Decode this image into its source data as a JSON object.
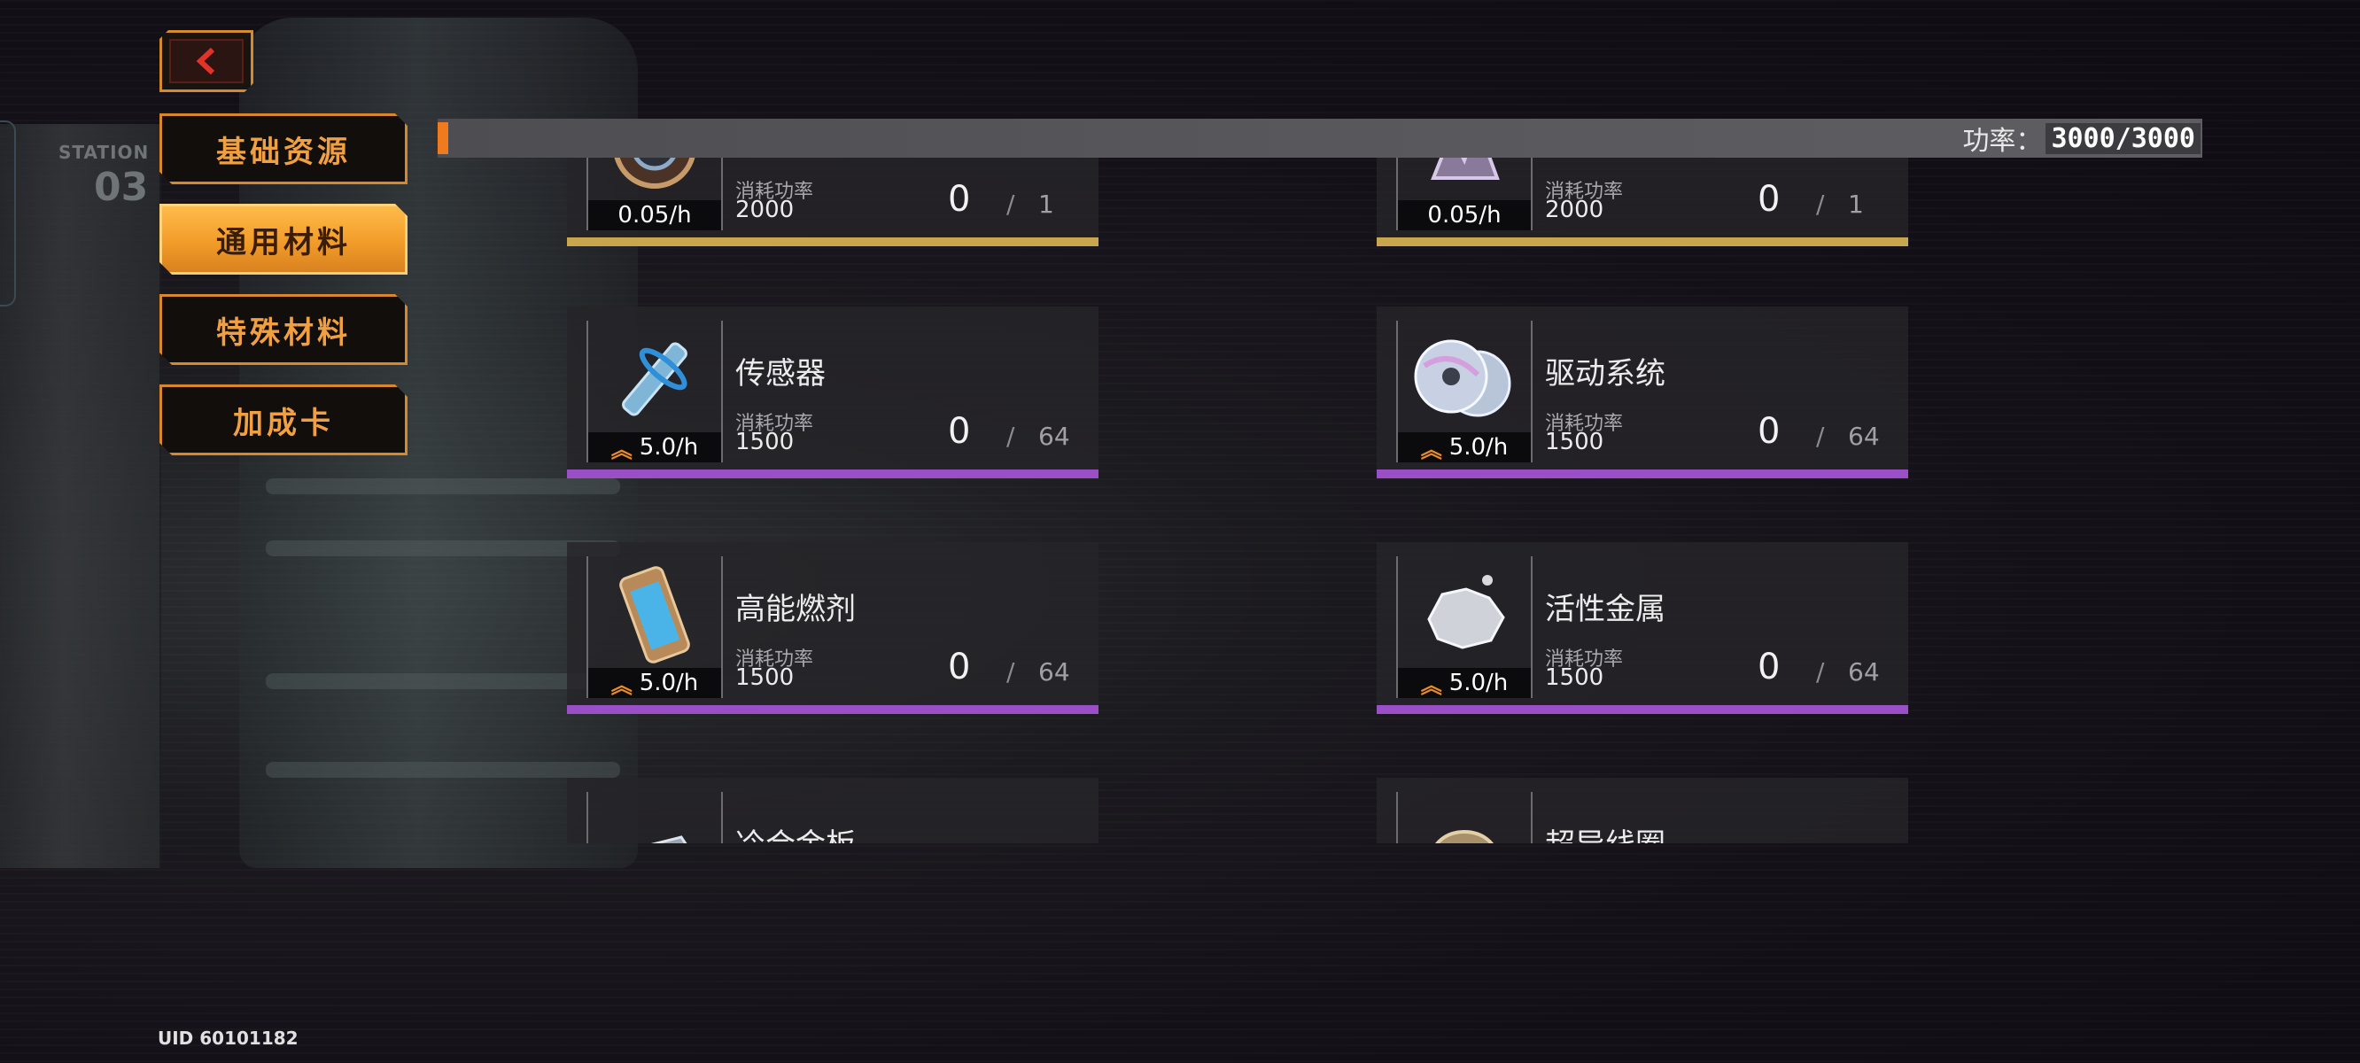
{
  "station": {
    "label": "STATION",
    "number": "03"
  },
  "tabs": [
    {
      "label": "基础资源",
      "active": false
    },
    {
      "label": "通用材料",
      "active": true
    },
    {
      "label": "特殊材料",
      "active": false
    },
    {
      "label": "加成卡",
      "active": false
    }
  ],
  "power": {
    "label": "功率：",
    "value": "3000/3000"
  },
  "consume_label": "消耗功率",
  "items": [
    {
      "name": "",
      "rate": "0.05/h",
      "consume": "2000",
      "count": "0",
      "max": "1",
      "rarity": "gold",
      "boosted": false,
      "icon": "clock-gear-icon"
    },
    {
      "name": "",
      "rate": "0.05/h",
      "consume": "2000",
      "count": "0",
      "max": "1",
      "rarity": "gold",
      "boosted": false,
      "icon": "crystal-cluster-icon"
    },
    {
      "name": "传感器",
      "rate": "5.0/h",
      "consume": "1500",
      "count": "0",
      "max": "64",
      "rarity": "purple",
      "boosted": true,
      "icon": "sensor-probe-icon"
    },
    {
      "name": "驱动系统",
      "rate": "5.0/h",
      "consume": "1500",
      "count": "0",
      "max": "64",
      "rarity": "purple",
      "boosted": true,
      "icon": "disc-drive-icon"
    },
    {
      "name": "高能燃剂",
      "rate": "5.0/h",
      "consume": "1500",
      "count": "0",
      "max": "64",
      "rarity": "purple",
      "boosted": true,
      "icon": "fuel-canister-icon"
    },
    {
      "name": "活性金属",
      "rate": "5.0/h",
      "consume": "1500",
      "count": "0",
      "max": "64",
      "rarity": "purple",
      "boosted": true,
      "icon": "metal-ore-icon"
    },
    {
      "name": "冷合金板",
      "rate": "",
      "consume": "",
      "count": "",
      "max": "",
      "rarity": "purple",
      "boosted": false,
      "icon": "alloy-plate-icon"
    },
    {
      "name": "超导线圈",
      "rate": "",
      "consume": "",
      "count": "",
      "max": "",
      "rarity": "purple",
      "boosted": false,
      "icon": "coil-icon"
    }
  ],
  "uid": "UID 60101182",
  "colors": {
    "accent": "#f07a1e",
    "gold": "#c9a54e",
    "purple": "#9b4fc6",
    "tab_border": "#d8872b"
  }
}
